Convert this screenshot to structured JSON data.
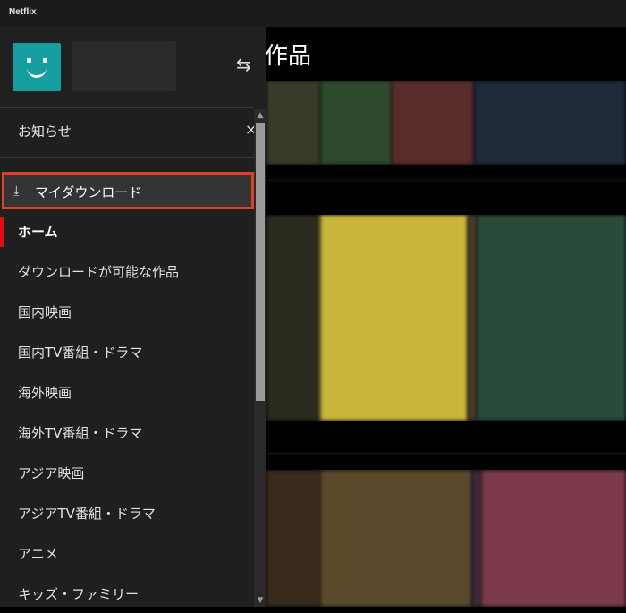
{
  "window": {
    "title": "Netflix"
  },
  "main": {
    "section_title": "作品",
    "rows": [
      {
        "tiles": [
          "#3a3a2a",
          "#2d4a2d",
          "#5a2b2b",
          "#1e2a3a"
        ]
      },
      {
        "tiles": [
          "#2a2a1e",
          "#c9b53a",
          "#4a3a2a",
          "#2a4a3a"
        ]
      },
      {
        "tiles": [
          "#3a2a1e",
          "#5a4a2a",
          "#3a2a3a",
          "#7a3a4a"
        ]
      }
    ]
  },
  "sidebar": {
    "switch_icon": "switch-profile-icon",
    "notice": {
      "label": "お知らせ",
      "close": "×"
    },
    "downloads": {
      "icon": "⤓",
      "label": "マイダウンロード"
    },
    "items": [
      {
        "label": "ホーム",
        "active": true
      },
      {
        "label": "ダウンロードが可能な作品"
      },
      {
        "label": "国内映画"
      },
      {
        "label": "国内TV番組・ドラマ"
      },
      {
        "label": "海外映画"
      },
      {
        "label": "海外TV番組・ドラマ"
      },
      {
        "label": "アジア映画"
      },
      {
        "label": "アジアTV番組・ドラマ"
      },
      {
        "label": "アニメ"
      },
      {
        "label": "キッズ・ファミリー"
      }
    ]
  },
  "colors": {
    "accent": "#e50914",
    "highlight_border": "#e2401f",
    "avatar": "#159ea0"
  }
}
